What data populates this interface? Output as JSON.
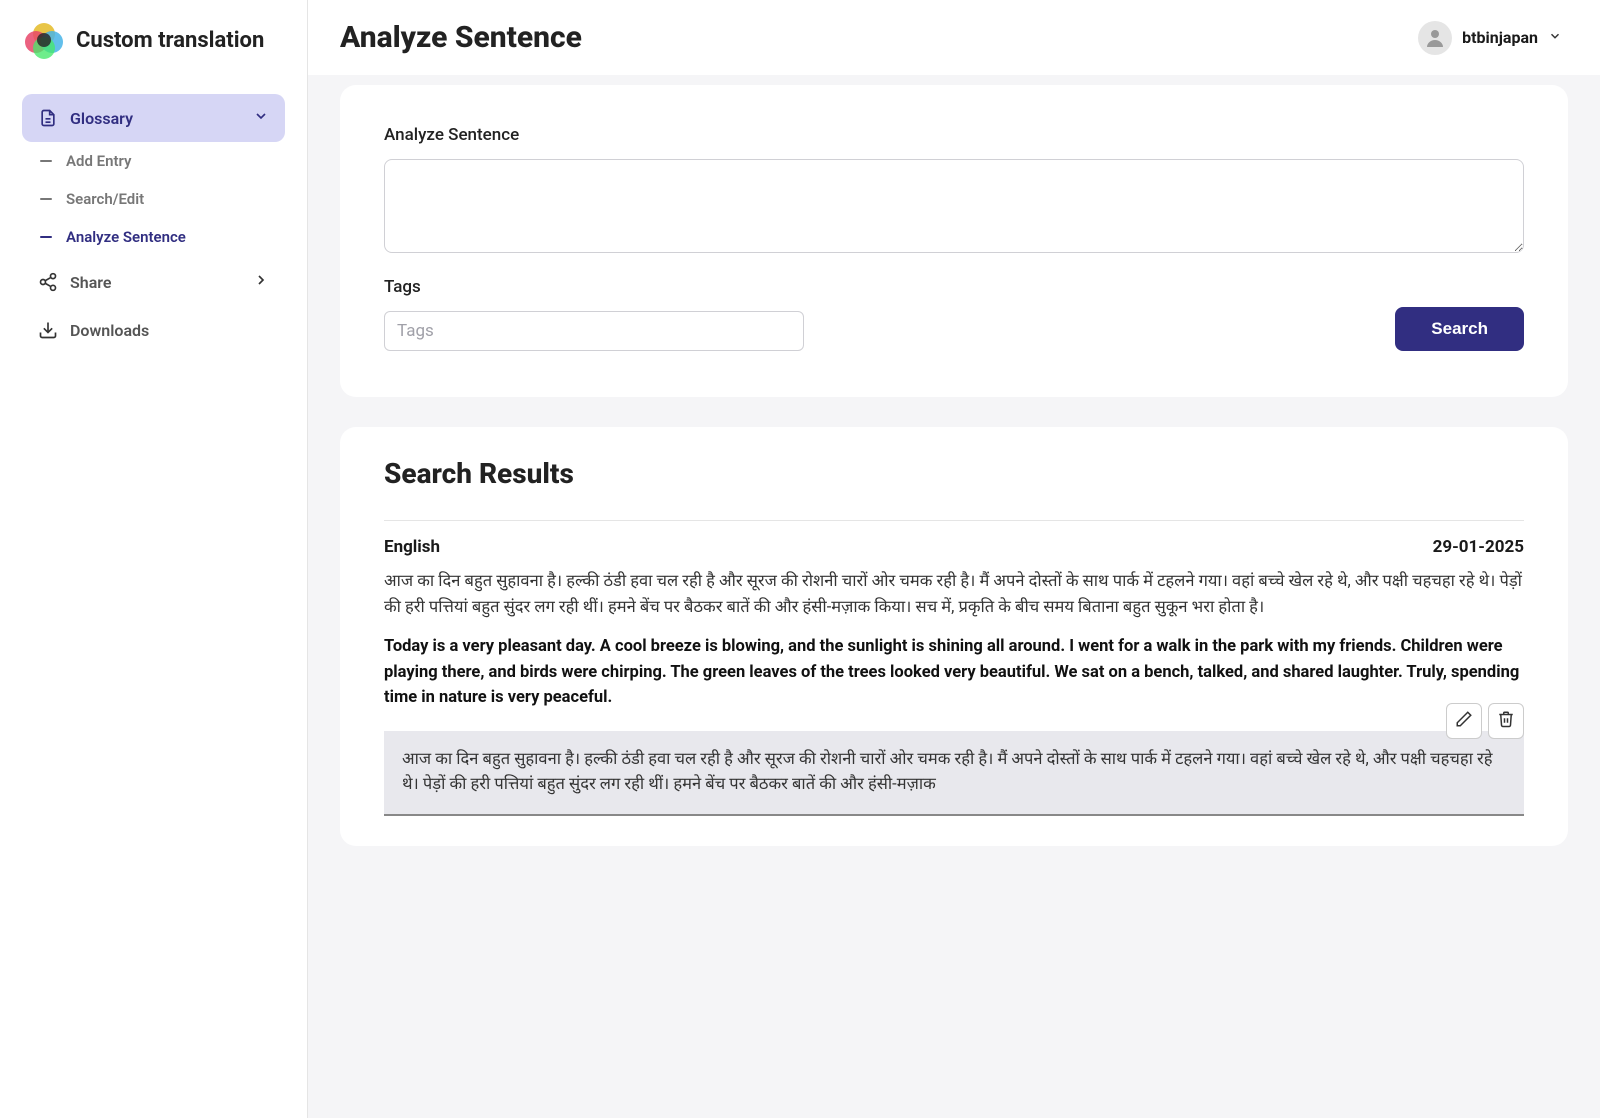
{
  "app": {
    "name": "Custom translation"
  },
  "user": {
    "name": "btbinjapan"
  },
  "sidebar": {
    "glossary_label": "Glossary",
    "items": [
      {
        "label": "Add Entry"
      },
      {
        "label": "Search/Edit"
      },
      {
        "label": "Analyze Sentence"
      }
    ],
    "share_label": "Share",
    "downloads_label": "Downloads"
  },
  "page": {
    "title": "Analyze Sentence"
  },
  "form": {
    "analyze_label": "Analyze Sentence",
    "tags_label": "Tags",
    "tags_placeholder": "Tags",
    "search_label": "Search"
  },
  "results": {
    "title": "Search Results",
    "entries": [
      {
        "language": "English",
        "date": "29-01-2025",
        "source": "आज का दिन बहुत सुहावना है। हल्की ठंडी हवा चल रही है और सूरज की रोशनी चारों ओर चमक रही है। मैं अपने दोस्तों के साथ पार्क में टहलने गया। वहां बच्चे खेल रहे थे, और पक्षी चहचहा रहे थे। पेड़ों की हरी पत्तियां बहुत सुंदर लग रही थीं। हमने बेंच पर बैठकर बातें की और हंसी-मज़ाक किया। सच में, प्रकृति के बीच समय बिताना बहुत सुकून भरा होता है।",
        "translation": "Today is a very pleasant day. A cool breeze is blowing, and the sunlight is shining all around. I went for a walk in the park with my friends. Children were playing there, and birds were chirping. The green leaves of the trees looked very beautiful. We sat on a bench, talked, and shared laughter. Truly, spending time in nature is very peaceful.",
        "highlighted": "आज का दिन बहुत सुहावना है। हल्की ठंडी हवा चल रही है और सूरज की रोशनी चारों ओर चमक रही है। मैं अपने दोस्तों के साथ पार्क में टहलने गया। वहां बच्चे खेल रहे थे, और पक्षी चहचहा रहे थे। पेड़ों की हरी पत्तियां बहुत सुंदर लग रही थीं। हमने बेंच पर बैठकर बातें की और हंसी-मज़ाक"
      }
    ]
  }
}
